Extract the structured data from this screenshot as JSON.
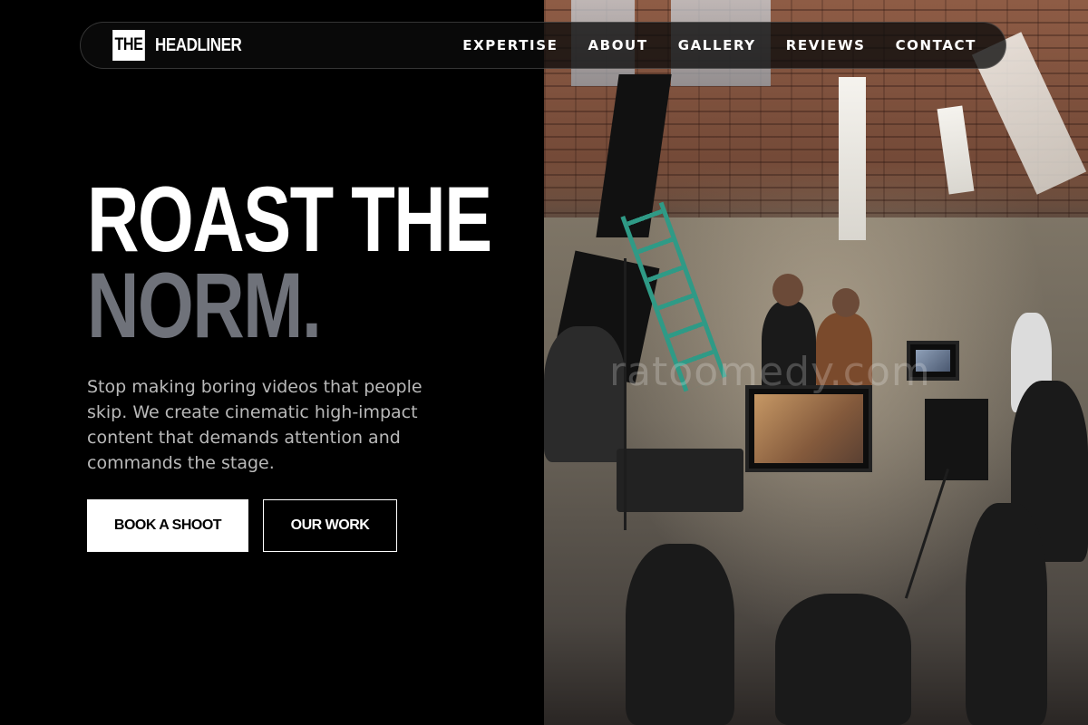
{
  "brand": {
    "logo_mark": "THE",
    "logo_text": "HEADLINER"
  },
  "nav": {
    "items": [
      {
        "label": "EXPERTISE"
      },
      {
        "label": "ABOUT"
      },
      {
        "label": "GALLERY"
      },
      {
        "label": "REVIEWS"
      },
      {
        "label": "CONTACT"
      }
    ]
  },
  "hero": {
    "headline_line1": "ROAST THE",
    "headline_line2": "NORM.",
    "subtext": "Stop making boring videos that people skip. We create cinematic high-impact content that demands attention and commands the stage.",
    "primary_cta": "BOOK A SHOOT",
    "secondary_cta": "OUR WORK"
  },
  "image": {
    "subject": "film-set-photo",
    "watermark": "ratoomedy.com"
  },
  "colors": {
    "background": "#000000",
    "headline_primary": "#ffffff",
    "headline_accent": "#6f727a",
    "body_text": "#b9b9b9"
  }
}
